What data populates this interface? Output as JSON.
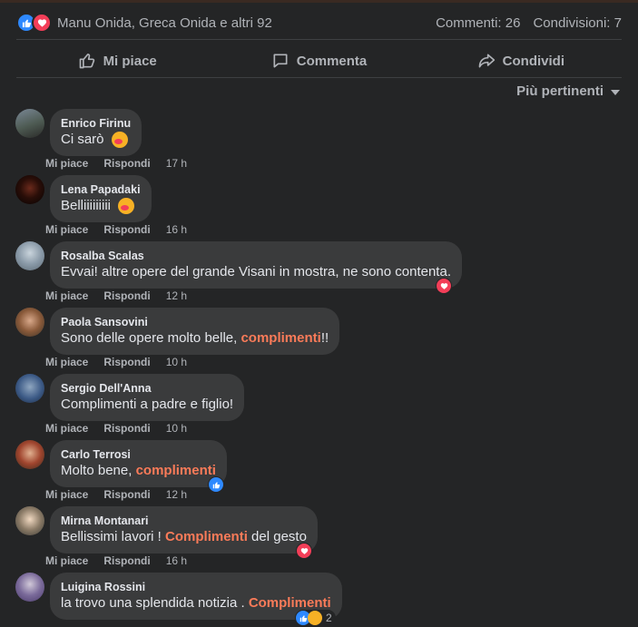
{
  "summary": {
    "names": "Manu Onida, Greca Onida e altri 92",
    "comments": "Commenti: 26",
    "shares": "Condivisioni: 7"
  },
  "actions": {
    "like": "Mi piace",
    "comment": "Commenta",
    "share": "Condividi"
  },
  "sort": {
    "label": "Più pertinenti"
  },
  "comment_actions": {
    "like": "Mi piace",
    "reply": "Rispondi"
  },
  "comments": [
    {
      "author": "Enrico Firinu",
      "time": "17 h"
    },
    {
      "author": "Lena Papadaki",
      "time": "16 h"
    },
    {
      "author": "Rosalba Scalas",
      "text": "Evvai! altre opere del grande Visani in mostra, ne sono contenta.",
      "time": "12 h"
    },
    {
      "author": "Paola Sansovini",
      "text_before": "Sono delle opere molto belle, ",
      "highlight": "complimenti",
      "text_after": "!!",
      "time": "10 h"
    },
    {
      "author": "Sergio Dell'Anna",
      "text": "Complimenti a padre e figlio!",
      "time": "10 h"
    },
    {
      "author": "Carlo Terrosi",
      "text_before": "Molto bene, ",
      "highlight": "complimenti",
      "time": "12 h"
    },
    {
      "author": "Mirna Montanari",
      "text_before": "Bellissimi lavori ! ",
      "highlight": "Complimenti",
      "text_after": " del gesto",
      "time": "16 h"
    },
    {
      "author": "Luigina Rossini",
      "text_before": "la trovo una splendida notizia . ",
      "highlight": "Complimenti",
      "reaction_count": "2"
    }
  ],
  "comment_texts": {
    "c0": "Ci sarò",
    "c1": "Belliiiiiiiii"
  },
  "colors": {
    "background": "#242526",
    "bubble": "#3a3b3c",
    "highlight": "#fa7b59",
    "like_blue": "#2e89ff",
    "love_red": "#f33e58",
    "care_yellow": "#f7b125"
  },
  "icons": {
    "like": "thumbs-up-icon",
    "love": "heart-icon",
    "care": "care-hug-icon",
    "comment": "speech-bubble-icon",
    "share": "share-arrow-icon"
  }
}
